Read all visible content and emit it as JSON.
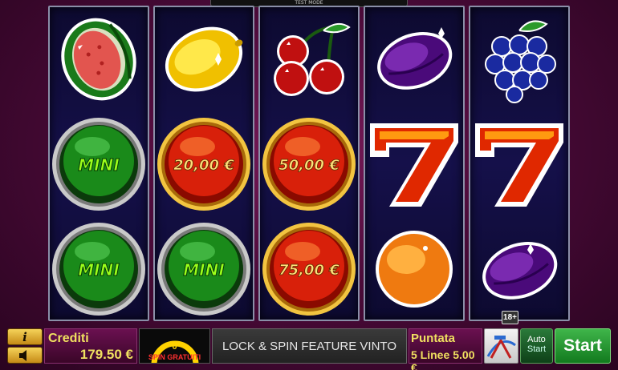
{
  "header": {
    "mode_label": "TEST MODE"
  },
  "reels": [
    {
      "symbols": [
        "watermelon",
        "mini-coin",
        "mini-coin"
      ]
    },
    {
      "symbols": [
        "lemon",
        "coin",
        "mini-coin"
      ],
      "coin_values": [
        "20,00 €"
      ]
    },
    {
      "symbols": [
        "cherries",
        "coin",
        "coin"
      ],
      "coin_values": [
        "50,00 €",
        "75,00 €"
      ]
    },
    {
      "symbols": [
        "plum",
        "seven",
        "orange"
      ]
    },
    {
      "symbols": [
        "grapes",
        "seven",
        "plum"
      ]
    }
  ],
  "coins": {
    "mini_label": "MINI",
    "reel2_value": "20,00 €",
    "reel3_value_top": "50,00 €",
    "reel3_value_bottom": "75,00 €"
  },
  "bottom_bar": {
    "info_label": "i",
    "credits_label": "Crediti",
    "credits_value": "179.50 €",
    "free_spins_count": "0",
    "free_spins_label": "SPIN GRATUITI",
    "message": "LOCK & SPIN FEATURE VINTO",
    "bet_label": "Puntata",
    "lines_label": "5 Linee",
    "bet_value": "5.00 €",
    "age_rating": "18+",
    "auto_label": "Auto",
    "auto_sub_label": "Start",
    "start_label": "Start"
  },
  "colors": {
    "background": "#4a0a38",
    "reel_bg": "#15104a",
    "text_gold": "#f0e060",
    "start_green": "#3fb54a",
    "coin_red": "#d8200a",
    "mini_green": "#1a8a1a"
  },
  "icons": {
    "info": "info-icon",
    "sound": "speaker-icon",
    "gamble": "gamble-meter-icon"
  }
}
